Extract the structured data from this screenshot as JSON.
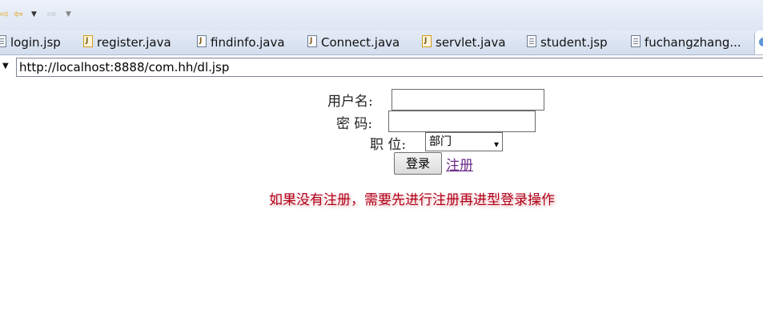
{
  "toolbar": {
    "icons": [
      "forward-arrow-icon",
      "back-arrow-icon",
      "dropdown-icon",
      "forward-arrow-icon",
      "dropdown-icon"
    ]
  },
  "tabs": [
    {
      "label": "login.jsp",
      "icon": "jsp-file-icon"
    },
    {
      "label": "register.java",
      "icon": "java-file-icon"
    },
    {
      "label": "findinfo.java",
      "icon": "java-file-icon"
    },
    {
      "label": "Connect.java",
      "icon": "java-file-icon"
    },
    {
      "label": "servlet.java",
      "icon": "java-file-icon"
    },
    {
      "label": "student.jsp",
      "icon": "jsp-file-icon"
    },
    {
      "label": "fuchangzhang...",
      "icon": "jsp-file-icon"
    }
  ],
  "address": {
    "url": "http://localhost:8888/com.hh/dl.jsp"
  },
  "form": {
    "username_label": "用户名:",
    "username_value": "",
    "password_label": "密 码:",
    "password_value": "",
    "position_label": "职 位:",
    "position_selected": "部门",
    "login_button": "登录",
    "register_link": "注册"
  },
  "notice": "如果没有注册，需要先进行注册再进型登录操作",
  "colors": {
    "link": "#6b2a87",
    "notice": "#b3001b",
    "toolbar_bg": "#e4ebf6"
  }
}
